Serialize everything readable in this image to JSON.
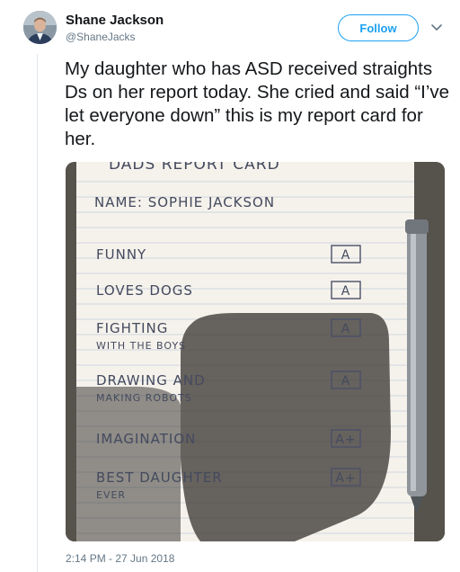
{
  "tweet": {
    "display_name": "Shane Jackson",
    "handle": "@ShaneJacks",
    "follow_label": "Follow",
    "text": "My daughter who has ASD received straights Ds on her report today. She cried and said “I’ve let everyone down” this is my report card for her.",
    "timestamp": "2:14 PM - 27 Jun 2018"
  },
  "report_card": {
    "heading": "DADS REPORT CARD",
    "name_line": "NAME: SOPHIE JACKSON",
    "items": [
      {
        "line1": "FUNNY",
        "line2": "",
        "grade": "A"
      },
      {
        "line1": "LOVES DOGS",
        "line2": "",
        "grade": "A"
      },
      {
        "line1": "FIGHTING",
        "line2": "WITH THE BOYS",
        "grade": "A"
      },
      {
        "line1": "DRAWING AND",
        "line2": "MAKING ROBOTS",
        "grade": "A"
      },
      {
        "line1": "IMAGINATION",
        "line2": "",
        "grade": "A+"
      },
      {
        "line1": "BEST DAUGHTER",
        "line2": "EVER",
        "grade": "A+"
      }
    ]
  }
}
